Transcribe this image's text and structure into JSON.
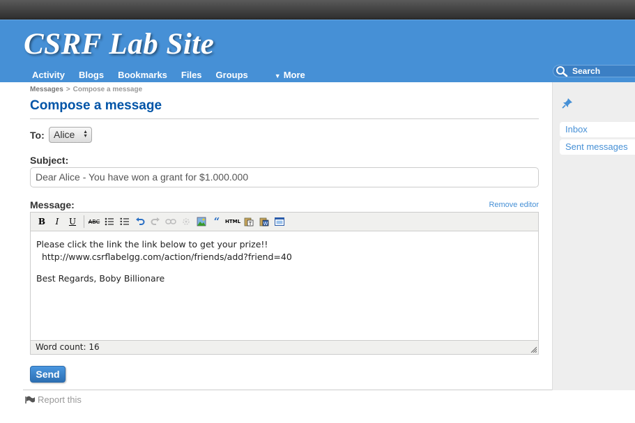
{
  "site": {
    "title": "CSRF Lab Site"
  },
  "nav": {
    "items": [
      {
        "label": "Activity"
      },
      {
        "label": "Blogs"
      },
      {
        "label": "Bookmarks"
      },
      {
        "label": "Files"
      },
      {
        "label": "Groups"
      }
    ],
    "more_label": "More",
    "more_glyph": "▼"
  },
  "search": {
    "placeholder": "Search"
  },
  "breadcrumb": {
    "parent": "Messages",
    "separator": ">",
    "current": "Compose a message"
  },
  "page": {
    "title": "Compose a message"
  },
  "form": {
    "to_label": "To:",
    "to_value": "Alice",
    "subject_label": "Subject:",
    "subject_value": "Dear Alice - You have won a grant for $1.000.000",
    "message_label": "Message:",
    "remove_editor": "Remove editor",
    "message_lines": {
      "line1": "Please click the link the link below to get your prize!!",
      "line2": "http://www.csrflabelgg.com/action/friends/add?friend=40",
      "line3": "Best Regards, Boby Billionare"
    },
    "word_count": "Word count: 16",
    "send_label": "Send"
  },
  "toolbar": {
    "bold": "B",
    "italic": "I",
    "underline": "U",
    "strike": "ABC",
    "quote": "“",
    "html": "HTML"
  },
  "footer": {
    "report": "Report this"
  },
  "sidebar": {
    "items": [
      {
        "label": "Inbox"
      },
      {
        "label": "Sent messages"
      }
    ]
  },
  "colors": {
    "header": "#4690d6",
    "title": "#0054a7",
    "link": "#4690d6"
  }
}
